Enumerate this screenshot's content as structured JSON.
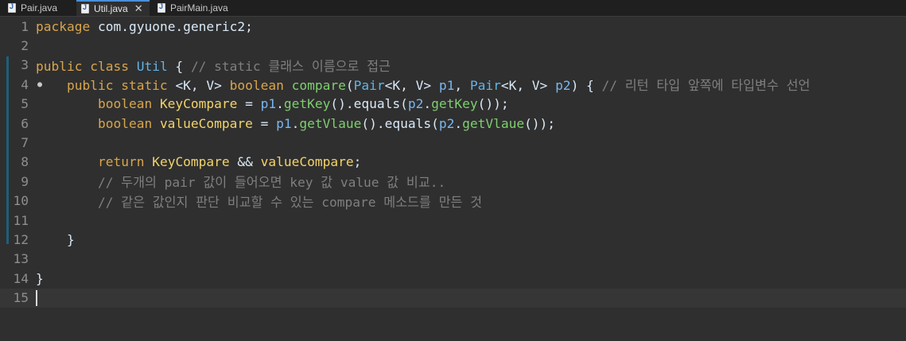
{
  "tabs": [
    {
      "label": "Pair.java"
    },
    {
      "label": "Util.java",
      "active": true
    },
    {
      "label": "PairMain.java"
    }
  ],
  "close_glyph": "✕",
  "fold_marker": "●",
  "lines": [
    {
      "num": "1",
      "tokens": [
        [
          "kw",
          "package"
        ],
        [
          "op",
          " com.gyuone.generic2;"
        ]
      ]
    },
    {
      "num": "2",
      "tokens": []
    },
    {
      "num": "3",
      "tokens": [
        [
          "kw",
          "public class "
        ],
        [
          "type",
          "Util"
        ],
        [
          "op",
          " { "
        ],
        [
          "cmt",
          "// static 클래스 이름으로 접근"
        ]
      ]
    },
    {
      "num": "4",
      "marker": true,
      "tokens": [
        [
          "op",
          "    "
        ],
        [
          "kw",
          "public static "
        ],
        [
          "op",
          "<K, V> "
        ],
        [
          "kw",
          "boolean "
        ],
        [
          "method",
          "compare"
        ],
        [
          "op",
          "("
        ],
        [
          "type",
          "Pair"
        ],
        [
          "op",
          "<K, V> "
        ],
        [
          "param",
          "p1"
        ],
        [
          "op",
          ", "
        ],
        [
          "type",
          "Pair"
        ],
        [
          "op",
          "<K, V> "
        ],
        [
          "param",
          "p2"
        ],
        [
          "op",
          ") { "
        ],
        [
          "cmt",
          "// 리턴 타입 앞쪽에 타입변수 선언"
        ]
      ]
    },
    {
      "num": "5",
      "tokens": [
        [
          "op",
          "        "
        ],
        [
          "kw",
          "boolean "
        ],
        [
          "var",
          "KeyCompare"
        ],
        [
          "op",
          " = "
        ],
        [
          "param",
          "p1"
        ],
        [
          "op",
          "."
        ],
        [
          "method",
          "getKey"
        ],
        [
          "op",
          "()."
        ],
        [
          "op",
          "equals("
        ],
        [
          "param",
          "p2"
        ],
        [
          "op",
          "."
        ],
        [
          "method",
          "getKey"
        ],
        [
          "op",
          "());"
        ]
      ]
    },
    {
      "num": "6",
      "tokens": [
        [
          "op",
          "        "
        ],
        [
          "kw",
          "boolean "
        ],
        [
          "var",
          "valueCompare"
        ],
        [
          "op",
          " = "
        ],
        [
          "param",
          "p1"
        ],
        [
          "op",
          "."
        ],
        [
          "method",
          "getVlaue"
        ],
        [
          "op",
          "()."
        ],
        [
          "op",
          "equals("
        ],
        [
          "param",
          "p2"
        ],
        [
          "op",
          "."
        ],
        [
          "method",
          "getVlaue"
        ],
        [
          "op",
          "());"
        ]
      ]
    },
    {
      "num": "7",
      "tokens": []
    },
    {
      "num": "8",
      "tokens": [
        [
          "op",
          "        "
        ],
        [
          "kw",
          "return "
        ],
        [
          "var",
          "KeyCompare"
        ],
        [
          "op",
          " && "
        ],
        [
          "var",
          "valueCompare"
        ],
        [
          "op",
          ";"
        ]
      ]
    },
    {
      "num": "9",
      "tokens": [
        [
          "op",
          "        "
        ],
        [
          "cmt",
          "// 두개의 pair 값이 들어오면 key 값 value 값 비교.."
        ]
      ]
    },
    {
      "num": "10",
      "tokens": [
        [
          "op",
          "        "
        ],
        [
          "cmt",
          "// 같은 값인지 판단 비교할 수 있는 compare 메소드를 만든 것"
        ]
      ]
    },
    {
      "num": "11",
      "tokens": []
    },
    {
      "num": "12",
      "tokens": [
        [
          "op",
          "    }"
        ]
      ]
    },
    {
      "num": "13",
      "tokens": []
    },
    {
      "num": "14",
      "tokens": [
        [
          "op",
          "}"
        ]
      ]
    },
    {
      "num": "15",
      "current": true,
      "caret": true,
      "tokens": []
    }
  ]
}
